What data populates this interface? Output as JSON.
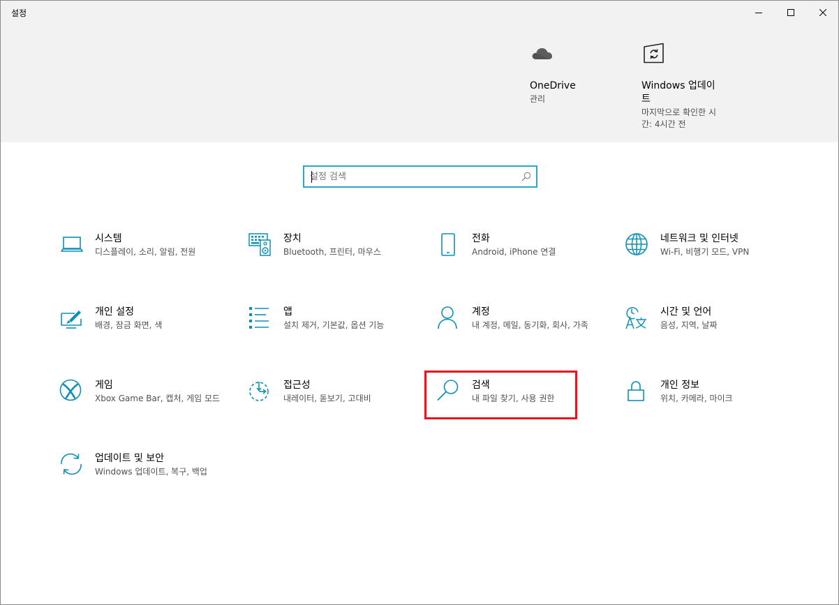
{
  "window": {
    "title": "설정",
    "controls": [
      "minimize-icon",
      "maximize-icon",
      "close-icon"
    ]
  },
  "quick_links": [
    {
      "title": "OneDrive",
      "subtitle": "관리",
      "icon": "cloud-icon"
    },
    {
      "title": "Windows 업데이트",
      "subtitle": "마지막으로 확인한 시간: 4시간 전",
      "icon": "windows-update-icon"
    }
  ],
  "search": {
    "placeholder": "설정 검색",
    "value": "",
    "icon": "search-icon"
  },
  "categories": [
    {
      "title": "시스템",
      "subtitle": "디스플레이, 소리, 알림, 전원",
      "icon": "laptop-icon"
    },
    {
      "title": "장치",
      "subtitle": "Bluetooth, 프린터, 마우스",
      "icon": "keyboard-speaker-icon"
    },
    {
      "title": "전화",
      "subtitle": "Android, iPhone 연결",
      "icon": "phone-icon"
    },
    {
      "title": "네트워크 및 인터넷",
      "subtitle": "Wi-Fi, 비행기 모드, VPN",
      "icon": "globe-icon"
    },
    {
      "title": "개인 설정",
      "subtitle": "배경, 잠금 화면, 색",
      "icon": "personalization-icon"
    },
    {
      "title": "앱",
      "subtitle": "설치 제거, 기본값, 옵션 기능",
      "icon": "apps-list-icon"
    },
    {
      "title": "계정",
      "subtitle": "내 계정, 메일, 동기화, 회사, 가족",
      "icon": "person-icon"
    },
    {
      "title": "시간 및 언어",
      "subtitle": "음성, 지역, 날짜",
      "icon": "time-language-icon"
    },
    {
      "title": "게임",
      "subtitle": "Xbox Game Bar, 캡처, 게임 모드",
      "icon": "xbox-icon"
    },
    {
      "title": "접근성",
      "subtitle": "내레이터, 돋보기, 고대비",
      "icon": "ease-of-access-icon"
    },
    {
      "title": "검색",
      "subtitle": "내 파일 찾기, 사용 권한",
      "icon": "search-icon"
    },
    {
      "title": "개인 정보",
      "subtitle": "위치, 카메라, 마이크",
      "icon": "lock-icon"
    },
    {
      "title": "업데이트 및 보안",
      "subtitle": "Windows 업데이트, 복구, 백업",
      "icon": "sync-icon"
    }
  ],
  "colors": {
    "accent": "#0e8fb5",
    "search_border": "#2aa6c6",
    "highlight_box": "#e3151f",
    "header_bg": "#f2f2f2"
  }
}
